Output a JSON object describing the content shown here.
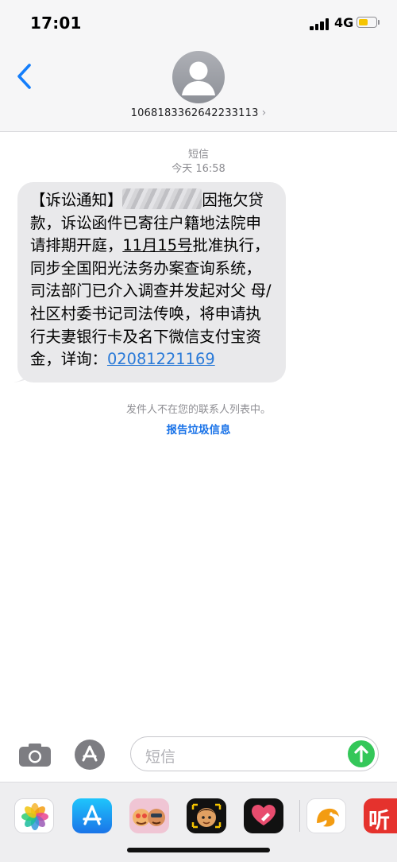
{
  "status_bar": {
    "time": "17:01",
    "network": "4G",
    "battery_fraction": 0.6,
    "battery_color": "#f5c400"
  },
  "header": {
    "back_icon": "chevron-left-icon",
    "contact_number": "1068183362642233113",
    "detail_chevron": "›"
  },
  "conversation": {
    "service_label": "短信",
    "timestamp": "今天 16:58",
    "message": {
      "part1": "【诉讼通知】",
      "redacted": "",
      "part2": "因拖欠贷款，诉讼函件已寄往户籍地法院申请排期开庭，",
      "date_link": "11月15号",
      "part3": "批准执行，同步全国阳光法务办案查询系统，司法部门已介入调查并发起对父 母/社区村委书记司法传唤，将申请执行夫妻银行卡及名下微信支付宝资金，详询：",
      "phone_link": "02081221169"
    },
    "notice": "发件人不在您的联系人列表中。",
    "report_link": "报告垃圾信息"
  },
  "composer": {
    "camera_icon": "camera-icon",
    "apps_icon": "app-store-icon",
    "placeholder": "短信",
    "send_icon": "arrow-up-icon",
    "send_color": "#34c759"
  },
  "app_drawer": {
    "apps": [
      {
        "name": "photos-app-icon"
      },
      {
        "name": "app-store-app-icon"
      },
      {
        "name": "memoji-stickers-icon"
      },
      {
        "name": "animoji-icon"
      },
      {
        "name": "digital-touch-icon"
      },
      {
        "name": "uc-browser-icon"
      },
      {
        "name": "listen-app-icon",
        "label": "听"
      }
    ]
  },
  "colors": {
    "header_bg": "#f6f6f7",
    "bubble_bg": "#e9e9eb",
    "link_blue": "#2a7ad8",
    "report_blue": "#1a73e8"
  }
}
